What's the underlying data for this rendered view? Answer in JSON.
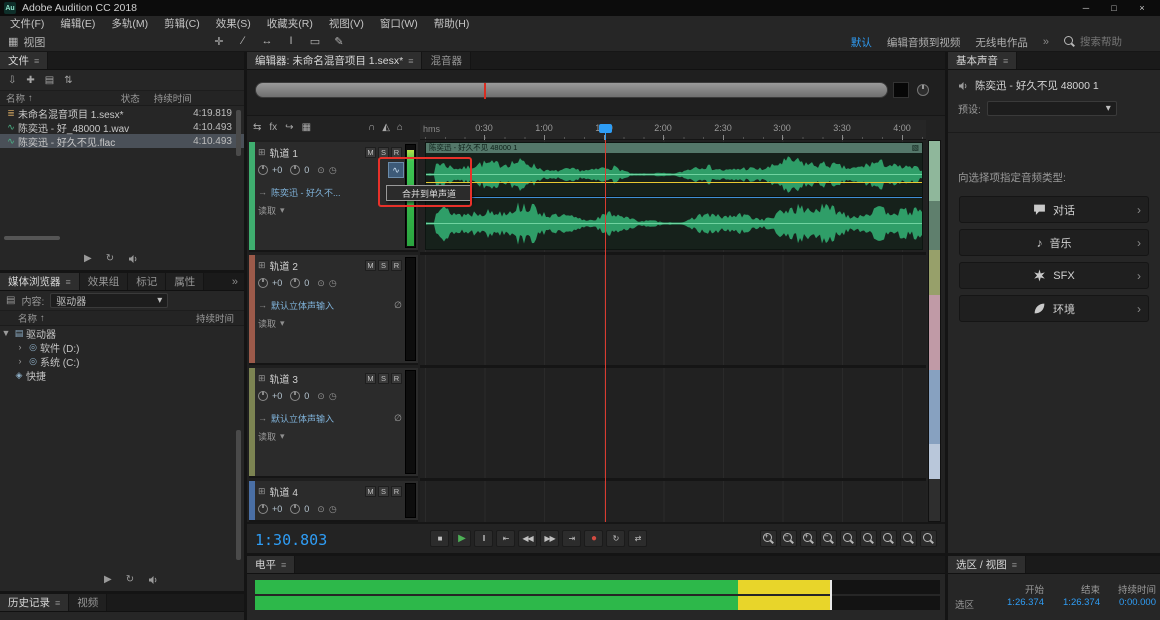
{
  "colors": {
    "accent_blue": "#2f9df5",
    "waveform_green": "#2f9e68",
    "playhead_red": "#d93b30",
    "annotation_red": "#e8312a",
    "meter_green": "#2db84a",
    "meter_yellow": "#e8d52a"
  },
  "titlebar": {
    "app_icon_text": "Au",
    "title": "Adobe Audition CC 2018",
    "minimize_glyph": "─",
    "maximize_glyph": "□",
    "close_glyph": "×"
  },
  "menubar": {
    "items": [
      "文件(F)",
      "编辑(E)",
      "多轨(M)",
      "剪辑(C)",
      "效果(S)",
      "收藏夹(R)",
      "视图(V)",
      "窗口(W)",
      "帮助(H)"
    ]
  },
  "toolbar": {
    "view_icon_glyph": "▦",
    "view_label": "视图",
    "tools": [
      {
        "name": "move-tool-icon",
        "glyph": "✛"
      },
      {
        "name": "razor-tool-icon",
        "glyph": "∕"
      },
      {
        "name": "slip-tool-icon",
        "glyph": "↔"
      },
      {
        "name": "time-selection-tool-icon",
        "glyph": "I"
      },
      {
        "name": "marquee-tool-icon",
        "glyph": "▭"
      },
      {
        "name": "paintbrush-tool-icon",
        "glyph": "✎"
      }
    ],
    "workspaces": [
      {
        "label": "默认"
      },
      {
        "label": "编辑音频到视频"
      },
      {
        "label": "无线电作品"
      }
    ],
    "active_workspace": "默认",
    "overflow_glyph": "»",
    "search_placeholder": "搜索帮助"
  },
  "files_panel": {
    "tab": "文件",
    "menu_glyph": "≡",
    "toolbar_icons": [
      {
        "name": "import-file-icon",
        "glyph": "⇩"
      },
      {
        "name": "new-content-icon",
        "glyph": "✚"
      },
      {
        "name": "open-file-icon",
        "glyph": "▤"
      },
      {
        "name": "sort-icon",
        "glyph": "⇅"
      }
    ],
    "columns": {
      "name": "名称",
      "sort_glyph": "↑",
      "status": "状态",
      "duration": "持续时间"
    },
    "rows": [
      {
        "name": "未命名混音项目 1.sesx*",
        "duration": "4:19.819"
      },
      {
        "name": "陈奕迅 - 好_48000 1.wav",
        "duration": "4:10.493"
      },
      {
        "name": "陈奕迅 - 好久不见.flac",
        "duration": "4:10.493"
      }
    ],
    "transport": [
      {
        "name": "play-button",
        "glyph": "▶"
      },
      {
        "name": "loop-button",
        "glyph": "↻"
      }
    ]
  },
  "media_browser": {
    "tabs": [
      "媒体浏览器",
      "效果组",
      "标记",
      "属性"
    ],
    "menu_glyph": "≡",
    "overflow_glyph": "»",
    "content_icon_glyph": "▤",
    "content_label": "内容:",
    "content_value": "驱动器",
    "dropdown_glyph": "▾",
    "columns": {
      "name": "名称",
      "sort_glyph": "↑",
      "duration": "持续时间"
    },
    "tree": [
      {
        "expander": "▼",
        "icon": "drive-icon",
        "icon_glyph": "▤",
        "label": "驱动器"
      },
      {
        "expander": "›",
        "icon": "disc-icon",
        "icon_glyph": "◎",
        "label": "软件 (D:)"
      },
      {
        "expander": "›",
        "icon": "disc-icon",
        "icon_glyph": "◎",
        "label": "系统 (C:)"
      },
      {
        "expander": "",
        "icon": "shortcut-icon",
        "icon_glyph": "◈",
        "label": "快捷"
      }
    ],
    "transport": [
      {
        "name": "play-button",
        "glyph": "▶"
      },
      {
        "name": "loop-button",
        "glyph": "↻"
      }
    ]
  },
  "history_panel": {
    "tabs": [
      "历史记录",
      "视频"
    ],
    "menu_glyph": "≡"
  },
  "editor": {
    "tab_active": "编辑器: 未命名混音项目 1.sesx*",
    "tab_inactive": "混音器",
    "menu_glyph": "≡",
    "toolbar_icons": [
      {
        "name": "track-io-icon",
        "glyph": "⇆"
      },
      {
        "name": "fx-rack-icon",
        "glyph": "fx"
      },
      {
        "name": "sends-icon",
        "glyph": "↪"
      },
      {
        "name": "eq-icon",
        "glyph": "▦"
      }
    ],
    "ruler_icons": [
      {
        "name": "snapping-icon",
        "glyph": "∩"
      },
      {
        "name": "metronome-icon",
        "glyph": "◭"
      },
      {
        "name": "video-icon",
        "glyph": "⌂"
      }
    ],
    "ruler_unit": "hms",
    "ruler_ticks": [
      "0:30",
      "1:00",
      "1:30",
      "2:00",
      "2:30",
      "3:00",
      "3:30",
      "4:00"
    ],
    "track_icon_glyph": "⊞",
    "io_glyph": "⊙",
    "clock_glyph": "◷",
    "dropdown_glyph": "▾",
    "clip_title": "陈奕迅 - 好久不见 48000 1",
    "clip_corner_glyph": "▧",
    "merge_button_glyph": "∿",
    "tooltip": "合并到单声道",
    "tracks": [
      {
        "name": "轨道 1",
        "mute": "M",
        "solo": "S",
        "arm": "R",
        "volume": "+0",
        "pan": "0",
        "route_glyph": "→",
        "route": "陈奕迅 - 好久不...",
        "phase_glyph": "",
        "mode": "读取",
        "color": "#3fae6f"
      },
      {
        "name": "轨道 2",
        "mute": "M",
        "solo": "S",
        "arm": "R",
        "volume": "+0",
        "pan": "0",
        "route_glyph": "→",
        "route": "默认立体声输入",
        "phase_glyph": "∅",
        "mode": "读取",
        "color": "#9c5a4a"
      },
      {
        "name": "轨道 3",
        "mute": "M",
        "solo": "S",
        "arm": "R",
        "volume": "+0",
        "pan": "0",
        "route_glyph": "→",
        "route": "默认立体声输入",
        "phase_glyph": "∅",
        "mode": "读取",
        "color": "#7c8452"
      },
      {
        "name": "轨道 4",
        "mute": "M",
        "solo": "S",
        "arm": "R",
        "volume": "+0",
        "pan": "0",
        "route_glyph": "",
        "route": "",
        "phase_glyph": "",
        "mode": "",
        "color": "#4a6fa5"
      }
    ],
    "time_display": "1:30.803",
    "transport": [
      {
        "name": "stop-button",
        "glyph": "■"
      },
      {
        "name": "play-button",
        "glyph": "▶"
      },
      {
        "name": "pause-button",
        "glyph": "‖"
      },
      {
        "name": "skip-to-start-button",
        "glyph": "⇤"
      },
      {
        "name": "rewind-button",
        "glyph": "◀◀"
      },
      {
        "name": "fast-forward-button",
        "glyph": "▶▶"
      },
      {
        "name": "skip-to-end-button",
        "glyph": "⇥"
      },
      {
        "name": "record-button",
        "glyph": "●"
      },
      {
        "name": "loop-playback-button",
        "glyph": "↻"
      },
      {
        "name": "skip-selection-button",
        "glyph": "⇄"
      }
    ],
    "zoom_buttons": [
      {
        "name": "zoom-in-time-button",
        "sign": "+"
      },
      {
        "name": "zoom-out-time-button",
        "sign": "−"
      },
      {
        "name": "zoom-in-amplitude-button",
        "sign": "+"
      },
      {
        "name": "zoom-out-amplitude-button",
        "sign": "−"
      },
      {
        "name": "zoom-to-selection-button",
        "sign": ""
      },
      {
        "name": "zoom-selection-in-button",
        "sign": ""
      },
      {
        "name": "zoom-selection-out-button",
        "sign": ""
      },
      {
        "name": "zoom-full-button",
        "sign": ""
      },
      {
        "name": "zoom-reset-button",
        "sign": ""
      }
    ]
  },
  "essential_sound": {
    "tab": "基本声音",
    "menu_glyph": "≡",
    "clip_name": "陈奕迅 - 好久不见 48000 1",
    "preset_label": "预设:",
    "dropdown_glyph": "▾",
    "assign_label": "向选择项指定音频类型:",
    "chevron_glyph": "›",
    "types": [
      {
        "icon": "dialogue-icon",
        "label": "对话"
      },
      {
        "icon": "music-icon",
        "label": "音乐",
        "glyph": "♪"
      },
      {
        "icon": "sfx-icon",
        "label": "SFX"
      },
      {
        "icon": "ambience-icon",
        "label": "环境"
      }
    ]
  },
  "selection_view": {
    "tab": "选区 / 视图",
    "menu_glyph": "≡",
    "columns": [
      "开始",
      "结束",
      "持续时间"
    ],
    "row_label": "选区",
    "start": "1:26.374",
    "end": "1:26.374",
    "duration": "0:00.000"
  },
  "levels": {
    "tab": "电平",
    "menu_glyph": "≡"
  }
}
